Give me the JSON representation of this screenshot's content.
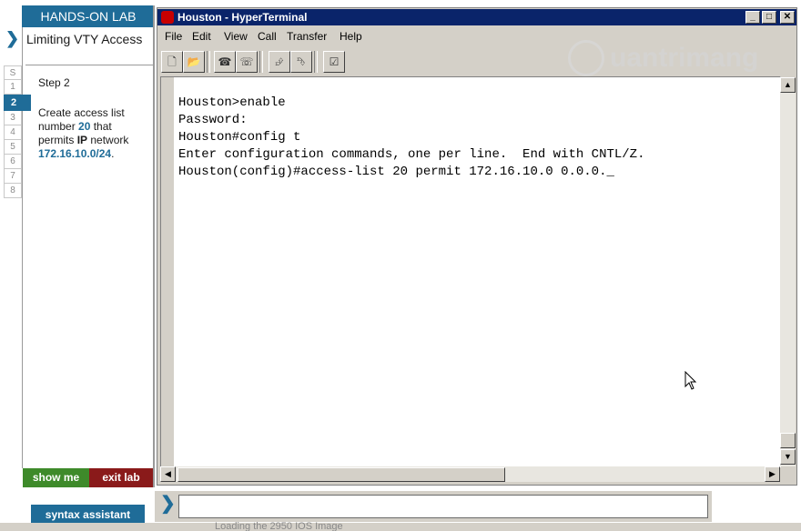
{
  "lab": {
    "header": "HANDS-ON LAB",
    "title": "Limiting VTY Access",
    "steps": [
      "S",
      "1",
      "2",
      "3",
      "4",
      "5",
      "6",
      "7",
      "8"
    ],
    "active_step": "2",
    "step_label": "Step 2",
    "desc_part1": "Create access list number ",
    "desc_number": "20",
    "desc_part2": " that permits ",
    "desc_ip": "IP",
    "desc_part3": " network ",
    "desc_network": "172.16.10.0/24",
    "desc_end": ".",
    "show_me": "show me",
    "exit_lab": "exit lab",
    "syntax_assistant": "syntax assistant"
  },
  "window": {
    "title": "Houston - HyperTerminal",
    "controls": {
      "minimize": "_",
      "maximize": "□",
      "close": "✕"
    },
    "menu": [
      "File",
      "Edit",
      "View",
      "Call",
      "Transfer",
      "Help"
    ]
  },
  "terminal": {
    "lines": [
      "Houston>enable",
      "Password:",
      "Houston#config t",
      "Enter configuration commands, one per line.  End with CNTL/Z.",
      "Houston(config)#access-list 20 permit 172.16.10.0 0.0.0._"
    ]
  },
  "watermark": "uantrimang",
  "command_input": {
    "value": "",
    "placeholder": ""
  },
  "taskbar": {
    "text": "Loading the 2950 IOS Image"
  },
  "colors": {
    "accent": "#1f6c98",
    "show_me": "#3e8a2a",
    "exit_lab": "#8a1a1a",
    "titlebar": "#0a246a"
  }
}
